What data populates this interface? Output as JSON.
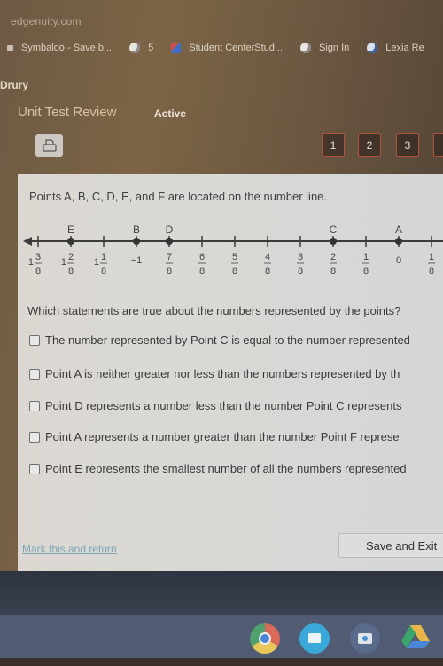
{
  "browser": {
    "url": "edgenuity.com",
    "bookmarks": [
      {
        "icon": "grid-icon",
        "label": "Symbaloo - Save b..."
      },
      {
        "icon": "globe-icon",
        "label": "5"
      },
      {
        "icon": "student-center-icon",
        "label": "Student CenterStud..."
      },
      {
        "icon": "globe-icon",
        "label": "Sign In"
      },
      {
        "icon": "lexia-icon",
        "label": "Lexia Re"
      }
    ]
  },
  "header": {
    "brand": "Drury",
    "title": "Unit Test Review",
    "status": "Active",
    "print_icon": "printer-icon",
    "question_nav": [
      "1",
      "2",
      "3"
    ]
  },
  "question": {
    "prompt": "Points A, B, C, D, E, and F are located on the number line.",
    "number_line": {
      "ticks": [
        {
          "value": -1.375,
          "whole": "−1",
          "num": "3",
          "den": "8"
        },
        {
          "value": -1.25,
          "whole": "−1",
          "num": "2",
          "den": "8"
        },
        {
          "value": -1.125,
          "whole": "−1",
          "num": "1",
          "den": "8"
        },
        {
          "value": -1,
          "whole": "−1",
          "num": "",
          "den": ""
        },
        {
          "value": -0.875,
          "whole": "−",
          "num": "7",
          "den": "8"
        },
        {
          "value": -0.75,
          "whole": "−",
          "num": "6",
          "den": "8"
        },
        {
          "value": -0.625,
          "whole": "−",
          "num": "5",
          "den": "8"
        },
        {
          "value": -0.5,
          "whole": "−",
          "num": "4",
          "den": "8"
        },
        {
          "value": -0.375,
          "whole": "−",
          "num": "3",
          "den": "8"
        },
        {
          "value": -0.25,
          "whole": "−",
          "num": "2",
          "den": "8"
        },
        {
          "value": -0.125,
          "whole": "−",
          "num": "1",
          "den": "8"
        },
        {
          "value": 0,
          "whole": "0",
          "num": "",
          "den": ""
        },
        {
          "value": 0.125,
          "whole": "",
          "num": "1",
          "den": "8"
        }
      ],
      "points": [
        {
          "label": "E",
          "value": -1.25
        },
        {
          "label": "B",
          "value": -1
        },
        {
          "label": "D",
          "value": -0.875
        },
        {
          "label": "C",
          "value": -0.25
        },
        {
          "label": "A",
          "value": 0
        }
      ]
    },
    "ask": "Which statements are true about the numbers represented by the points?",
    "options": [
      {
        "text": "The number represented by Point C is equal to the number represented",
        "checked": false
      },
      {
        "text": "Point A is neither greater nor less than the numbers represented by th",
        "checked": false
      },
      {
        "text": "Point D represents a number less than the number Point C represents",
        "checked": false
      },
      {
        "text": "Point A represents a number greater than the number Point F represe",
        "checked": false
      },
      {
        "text": "Point E represents the smallest number of all the numbers represented",
        "checked": false
      }
    ]
  },
  "footer": {
    "mark_link": "Mark this and return",
    "save_button": "Save and Exit"
  },
  "shelf": {
    "apps": [
      "chrome-icon",
      "files-icon",
      "camera-icon",
      "drive-icon"
    ]
  }
}
